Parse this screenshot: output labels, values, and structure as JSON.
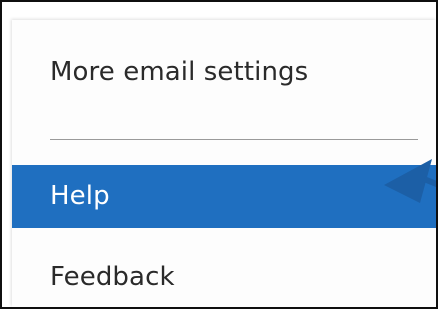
{
  "menu": {
    "items": [
      {
        "label": "More email settings"
      },
      {
        "label": "Help",
        "selected": true
      },
      {
        "label": "Feedback"
      }
    ]
  },
  "colors": {
    "selected_background": "#1f6fc0",
    "selected_text": "#ffffff",
    "text": "#2a2a2a",
    "annotation_arrow": "#1c5fa6"
  },
  "icons": {
    "annotation": "arrow-pointer-icon"
  }
}
